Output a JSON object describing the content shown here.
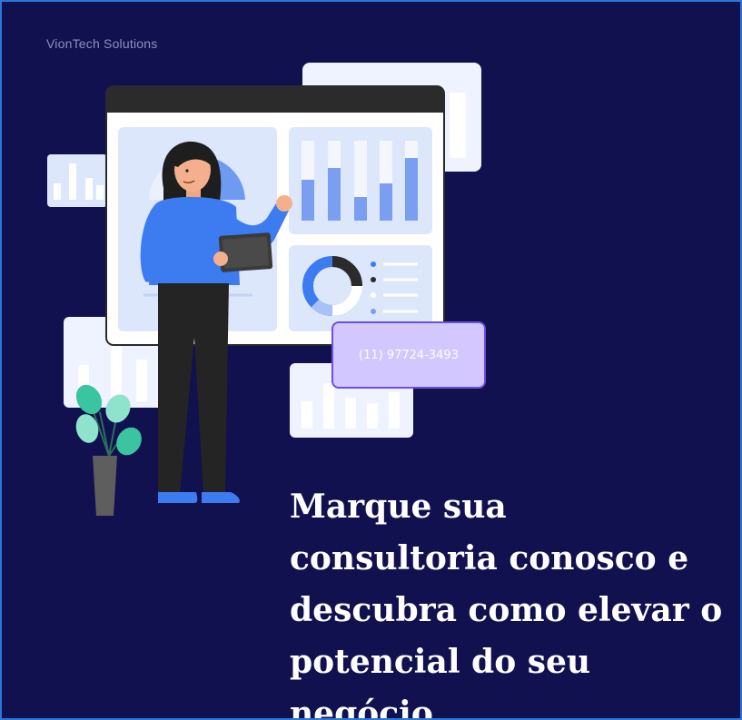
{
  "brand": {
    "name": "VionTech Solutions"
  },
  "cta": {
    "phone": "(11) 97724-3493"
  },
  "headline": {
    "text": "Marque sua consultoria conosco e descubra como elevar o potencial do seu negócio."
  },
  "colors": {
    "background": "#11114f",
    "border": "#2a78d8",
    "phone_box_fill": "#d2c8ff",
    "phone_box_border": "#6b4fe0",
    "accent_blue": "#3d7bf0",
    "headline": "#ffffff"
  },
  "illustration": {
    "icons": [
      "dashboard-window-icon",
      "woman-presenter-icon",
      "tablet-icon",
      "plant-icon",
      "bar-chart-icon",
      "donut-chart-icon"
    ]
  }
}
